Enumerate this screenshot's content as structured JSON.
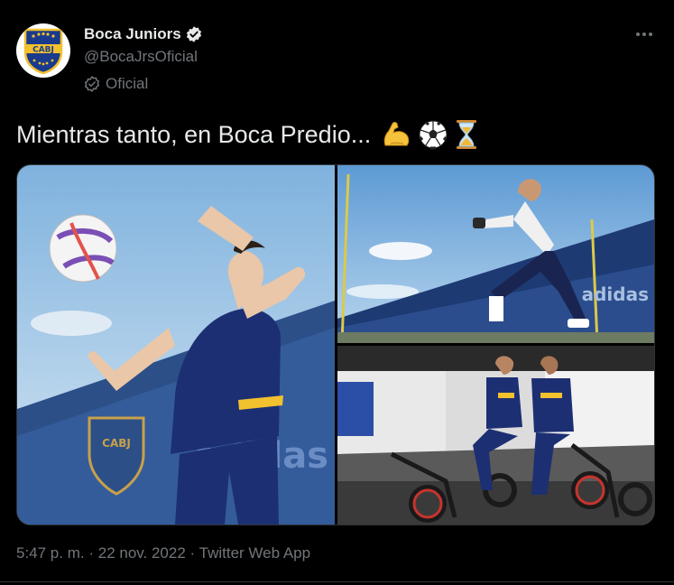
{
  "tweet": {
    "author": {
      "display_name": "Boca Juniors",
      "handle": "@BocaJrsOficial",
      "badge_label": "Oficial",
      "avatar_text": "CABJ",
      "verified": true
    },
    "text": "Mientras tanto, en Boca Predio...",
    "emojis": [
      "flexed-biceps",
      "soccer-ball",
      "hourglass"
    ],
    "media": [
      {
        "alt": "player-juggling-ball-photo",
        "logo_text": "CABJ",
        "banner_text": "adidas"
      },
      {
        "alt": "goalkeeper-training-photo",
        "banner_text": "adidas"
      },
      {
        "alt": "players-on-exercise-bikes-photo"
      }
    ],
    "timestamp": "5:47 p. m.",
    "date": "22 nov. 2022",
    "source": "Twitter Web App",
    "separator": "·"
  },
  "colors": {
    "background": "#000000",
    "text_primary": "#e7e9ea",
    "text_secondary": "#71767b",
    "boca_blue": "#1a3a8c",
    "boca_gold": "#f2c12e"
  }
}
